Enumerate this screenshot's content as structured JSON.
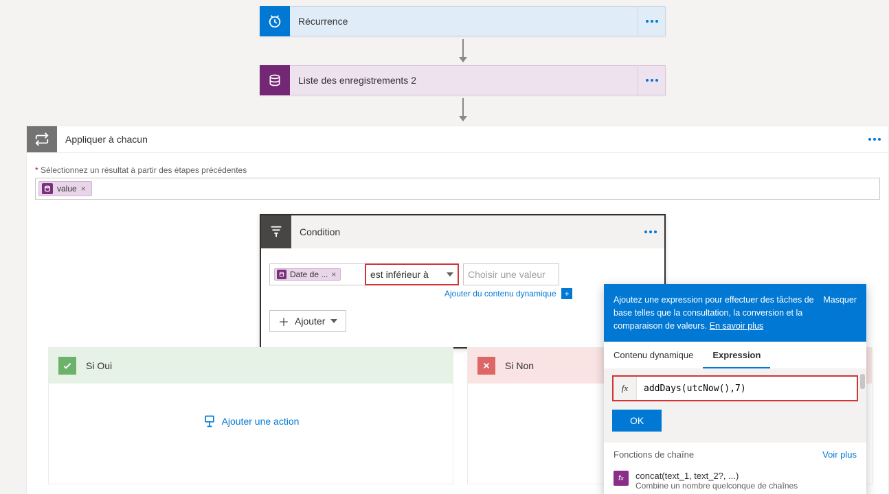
{
  "flow": {
    "recurrence": {
      "label": "Récurrence"
    },
    "list_records": {
      "label": "Liste des enregistrements 2"
    }
  },
  "apply_each": {
    "title": "Appliquer à chacun",
    "field_label": "Sélectionnez un résultat à partir des étapes précédentes",
    "token": "value"
  },
  "condition": {
    "title": "Condition",
    "left_token": "Date de ...",
    "operator": "est inférieur à",
    "right_placeholder": "Choisir une valeur",
    "add_dynamic": "Ajouter du contenu dynamique",
    "add_button": "Ajouter"
  },
  "branches": {
    "yes": {
      "title": "Si Oui",
      "add_action": "Ajouter une action"
    },
    "no": {
      "title": "Si Non"
    }
  },
  "popup": {
    "help_text": "Ajoutez une expression pour effectuer des tâches de base telles que la consultation, la conversion et la comparaison de valeurs.",
    "learn_more": "En savoir plus",
    "mask": "Masquer",
    "tabs": {
      "dynamic": "Contenu dynamique",
      "expression": "Expression"
    },
    "fx_label": "fx",
    "expression_value": "addDays(utcNow(),7)",
    "ok": "OK",
    "section": "Fonctions de chaîne",
    "see_more": "Voir plus",
    "func": {
      "signature": "concat(text_1, text_2?, ...)",
      "description": "Combine un nombre quelconque de chaînes"
    }
  },
  "icons": {
    "clock": "clock-icon",
    "db": "database-icon",
    "loop": "loop-icon",
    "cond": "condition-icon",
    "check": "check-icon",
    "cross": "cross-icon",
    "add_action": "add-action-icon"
  }
}
